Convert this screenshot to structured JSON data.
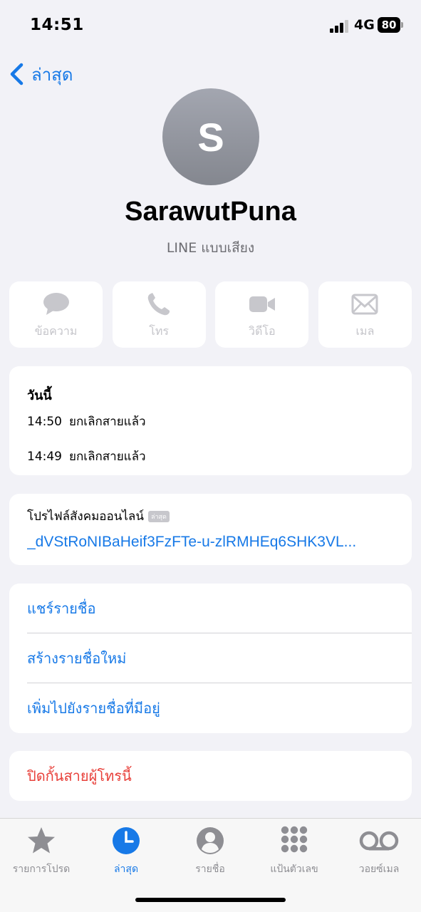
{
  "status": {
    "time": "14:51",
    "network": "4G",
    "battery": "80"
  },
  "nav": {
    "back_label": "ล่าสุด"
  },
  "contact": {
    "initial": "S",
    "name": "SarawutPuna",
    "subtitle": "LINE แบบเสียง"
  },
  "actions": [
    {
      "label": "ข้อความ",
      "icon": "message-icon"
    },
    {
      "label": "โทร",
      "icon": "phone-icon"
    },
    {
      "label": "วิดีโอ",
      "icon": "video-icon"
    },
    {
      "label": "เมล",
      "icon": "mail-icon"
    }
  ],
  "recents": {
    "title": "วันนี้",
    "rows": [
      {
        "time": "14:50",
        "status": "ยกเลิกสายแล้ว"
      },
      {
        "time": "14:49",
        "status": "ยกเลิกสายแล้ว"
      }
    ]
  },
  "profile": {
    "title": "โปรไฟล์สังคมออนไลน์",
    "badge": "ล่าสุด",
    "link": "_dVStRoNIBaHeif3FzFTe-u-zlRMHEq6SHK3VL..."
  },
  "options": [
    {
      "label": "แชร์รายชื่อ"
    },
    {
      "label": "สร้างรายชื่อใหม่"
    },
    {
      "label": "เพิ่มไปยังรายชื่อที่มีอยู่"
    }
  ],
  "block": {
    "label": "ปิดกั้นสายผู้โทรนี้"
  },
  "tabs": [
    {
      "label": "รายการโปรด",
      "icon": "star-icon",
      "active": false
    },
    {
      "label": "ล่าสุด",
      "icon": "clock-icon",
      "active": true
    },
    {
      "label": "รายชื่อ",
      "icon": "person-icon",
      "active": false
    },
    {
      "label": "แป้นตัวเลข",
      "icon": "keypad-icon",
      "active": false
    },
    {
      "label": "วอยซ์เมล",
      "icon": "voicemail-icon",
      "active": false
    }
  ],
  "colors": {
    "accent": "#1779e7",
    "destructive": "#e8403a",
    "disabled": "#c5c5ca",
    "background": "#f2f2f7"
  }
}
